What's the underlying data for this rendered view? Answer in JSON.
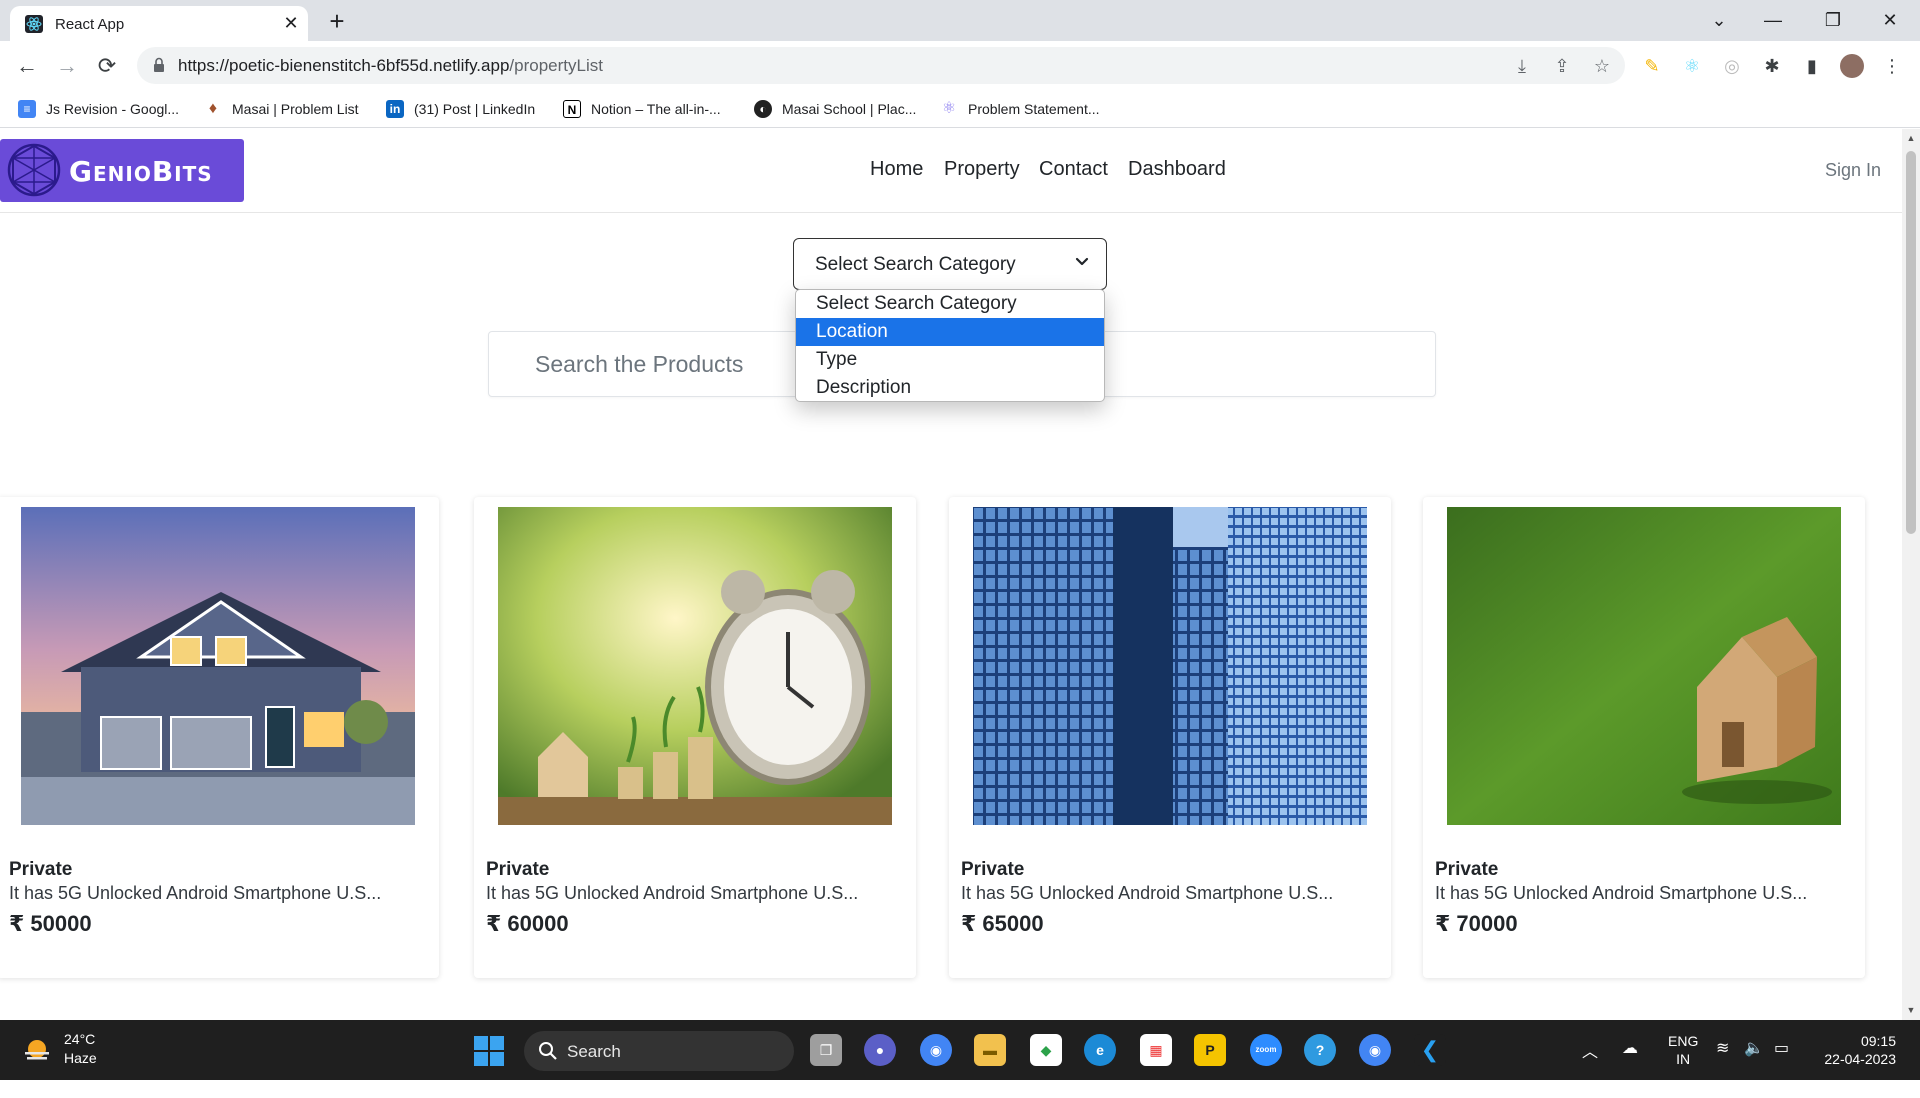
{
  "browser": {
    "tab_title": "React App",
    "url_host": "https://poetic-bienenstitch-6bf55d.netlify.app",
    "url_path": "/propertyList",
    "bookmarks": [
      {
        "label": "Js Revision - Googl...",
        "icon": "google-docs-icon",
        "color": "#4285f4"
      },
      {
        "label": "Masai | Problem List",
        "icon": "masai-icon",
        "color": "#a0522d"
      },
      {
        "label": "(31) Post | LinkedIn",
        "icon": "linkedin-icon",
        "color": "#0a66c2"
      },
      {
        "label": "Notion – The all-in-...",
        "icon": "notion-icon",
        "color": "#000000"
      },
      {
        "label": "Masai School | Plac...",
        "icon": "globe-icon",
        "color": "#222222"
      },
      {
        "label": "Problem Statement...",
        "icon": "react-icon",
        "color": "#8a7cf0"
      }
    ]
  },
  "site": {
    "brand": "GenioBits",
    "nav": [
      "Home",
      "Property",
      "Contact",
      "Dashboard"
    ],
    "sign_in": "Sign In",
    "select": {
      "value": "Select Search Category",
      "options": [
        "Select Search Category",
        "Location",
        "Type",
        "Description"
      ],
      "highlighted": "Location"
    },
    "search_placeholder": "Search the Products",
    "cards": [
      {
        "type": "Private",
        "desc": "It has 5G Unlocked Android Smartphone U.S...",
        "price": "₹ 50000",
        "image": "house-photo"
      },
      {
        "type": "Private",
        "desc": "It has 5G Unlocked Android Smartphone U.S...",
        "price": "₹ 60000",
        "image": "clock-coins-photo"
      },
      {
        "type": "Private",
        "desc": "It has 5G Unlocked Android Smartphone U.S...",
        "price": "₹ 65000",
        "image": "skyscraper-photo"
      },
      {
        "type": "Private",
        "desc": "It has 5G Unlocked Android Smartphone U.S...",
        "price": "₹ 70000",
        "image": "wooden-house-grass-photo"
      }
    ]
  },
  "taskbar": {
    "temp": "24°C",
    "condition": "Haze",
    "search_label": "Search",
    "lang": "ENG",
    "region": "IN",
    "time": "09:15",
    "date": "22-04-2023"
  }
}
